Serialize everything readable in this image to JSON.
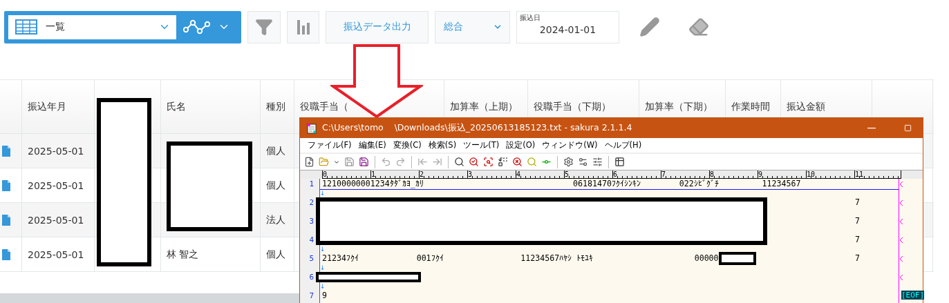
{
  "toolbar": {
    "view_select": {
      "value": "一覧"
    },
    "export_button": "振込データ出力",
    "summary_select": {
      "value": "総合"
    },
    "date_field": {
      "label": "振込日",
      "value": "2024-01-01"
    }
  },
  "table": {
    "columns": [
      {
        "kind": "blank"
      },
      {
        "kind": "label",
        "label": "振込年月"
      },
      {
        "kind": "redacted"
      },
      {
        "kind": "label",
        "label": "氏名"
      },
      {
        "kind": "label",
        "label": "種別"
      },
      {
        "kind": "label",
        "label": "役職手当（"
      },
      {
        "kind": "label",
        "label": "加算率（上期）"
      },
      {
        "kind": "label",
        "label": "役職手当（下期）"
      },
      {
        "kind": "label",
        "label": "加算率（下期）"
      },
      {
        "kind": "label",
        "label": "作業時間"
      },
      {
        "kind": "label",
        "label": "振込金額"
      },
      {
        "kind": "blank"
      }
    ],
    "rows": [
      {
        "date": "2025-05-01",
        "type": "個人"
      },
      {
        "date": "2025-05-01",
        "type": "個人"
      },
      {
        "date": "2025-05-01",
        "type": "法人"
      },
      {
        "date": "2025-05-01",
        "name": "林 智之",
        "type": "個人"
      }
    ]
  },
  "editor": {
    "title": "C:\\Users\\tomo",
    "title_rest": "\\Downloads\\振込_20250613185123.txt - sakura 2.1.1.4",
    "menu": [
      "ファイル(F)",
      "編集(E)",
      "変換(C)",
      "検索(S)",
      "ツール(T)",
      "設定(O)",
      "ウィンドウ(W)",
      "ヘルプ(H)"
    ],
    "ruler": [
      "0",
      "1",
      "2",
      "3",
      "4",
      "5",
      "6",
      "7",
      "8",
      "9",
      "10",
      "11"
    ],
    "lines": [
      {
        "number": "1",
        "text": "12100000001234ﾀﾀﾞｶﾖ_ｶﾘ                               06181470ﾌｸｲｼﾝｷﾝ        022ｼﾋﾞｸﾞﾁ         11234567",
        "eol": "↓",
        "current": true,
        "wrap_mark": true
      },
      {
        "number": "2",
        "tail": "7",
        "current": false,
        "wrap_mark": true
      },
      {
        "number": "3",
        "tail": "7",
        "current": false,
        "wrap_mark": true
      },
      {
        "number": "4",
        "tail": "7",
        "eol": "↓",
        "current": false,
        "wrap_mark": true
      },
      {
        "number": "5",
        "text": "21234ﾌｸｲ            001ﾌｸｲ                11234567ﾊﾔｼ ﾄﾓﾕｷ                     00000",
        "masked": true,
        "tail": "7",
        "eol": "↓",
        "current": false,
        "wrap_mark": true
      },
      {
        "number": "6",
        "eol": "↓",
        "current": false,
        "wrap_mark": true
      },
      {
        "number": "7",
        "text": "9",
        "current": false,
        "wrap_mark": false,
        "eof": "[EOF]"
      }
    ]
  }
}
